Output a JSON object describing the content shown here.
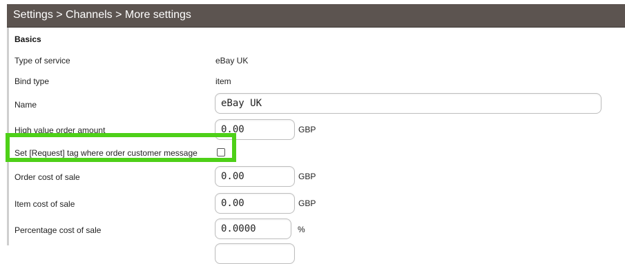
{
  "header": {
    "breadcrumb": "Settings > Channels > More settings"
  },
  "section": {
    "title": "Basics"
  },
  "rows": {
    "service_type": {
      "label": "Type of service",
      "value": "eBay UK"
    },
    "bind_type": {
      "label": "Bind type",
      "value": "item"
    },
    "name": {
      "label": "Name",
      "value": "eBay UK"
    },
    "high_value": {
      "label": "High value order amount",
      "value": "0.00",
      "unit": "GBP"
    },
    "request_tag": {
      "label": "Set [Request] tag where order customer message",
      "checked": false
    },
    "order_cost": {
      "label": "Order cost of sale",
      "value": "0.00",
      "unit": "GBP"
    },
    "item_cost": {
      "label": "Item cost of sale",
      "value": "0.00",
      "unit": "GBP"
    },
    "percent_cost": {
      "label": "Percentage cost of sale",
      "value": "0.0000",
      "unit": "%"
    }
  },
  "colors": {
    "header_bg": "#5c5450",
    "highlight": "#4ed018"
  }
}
